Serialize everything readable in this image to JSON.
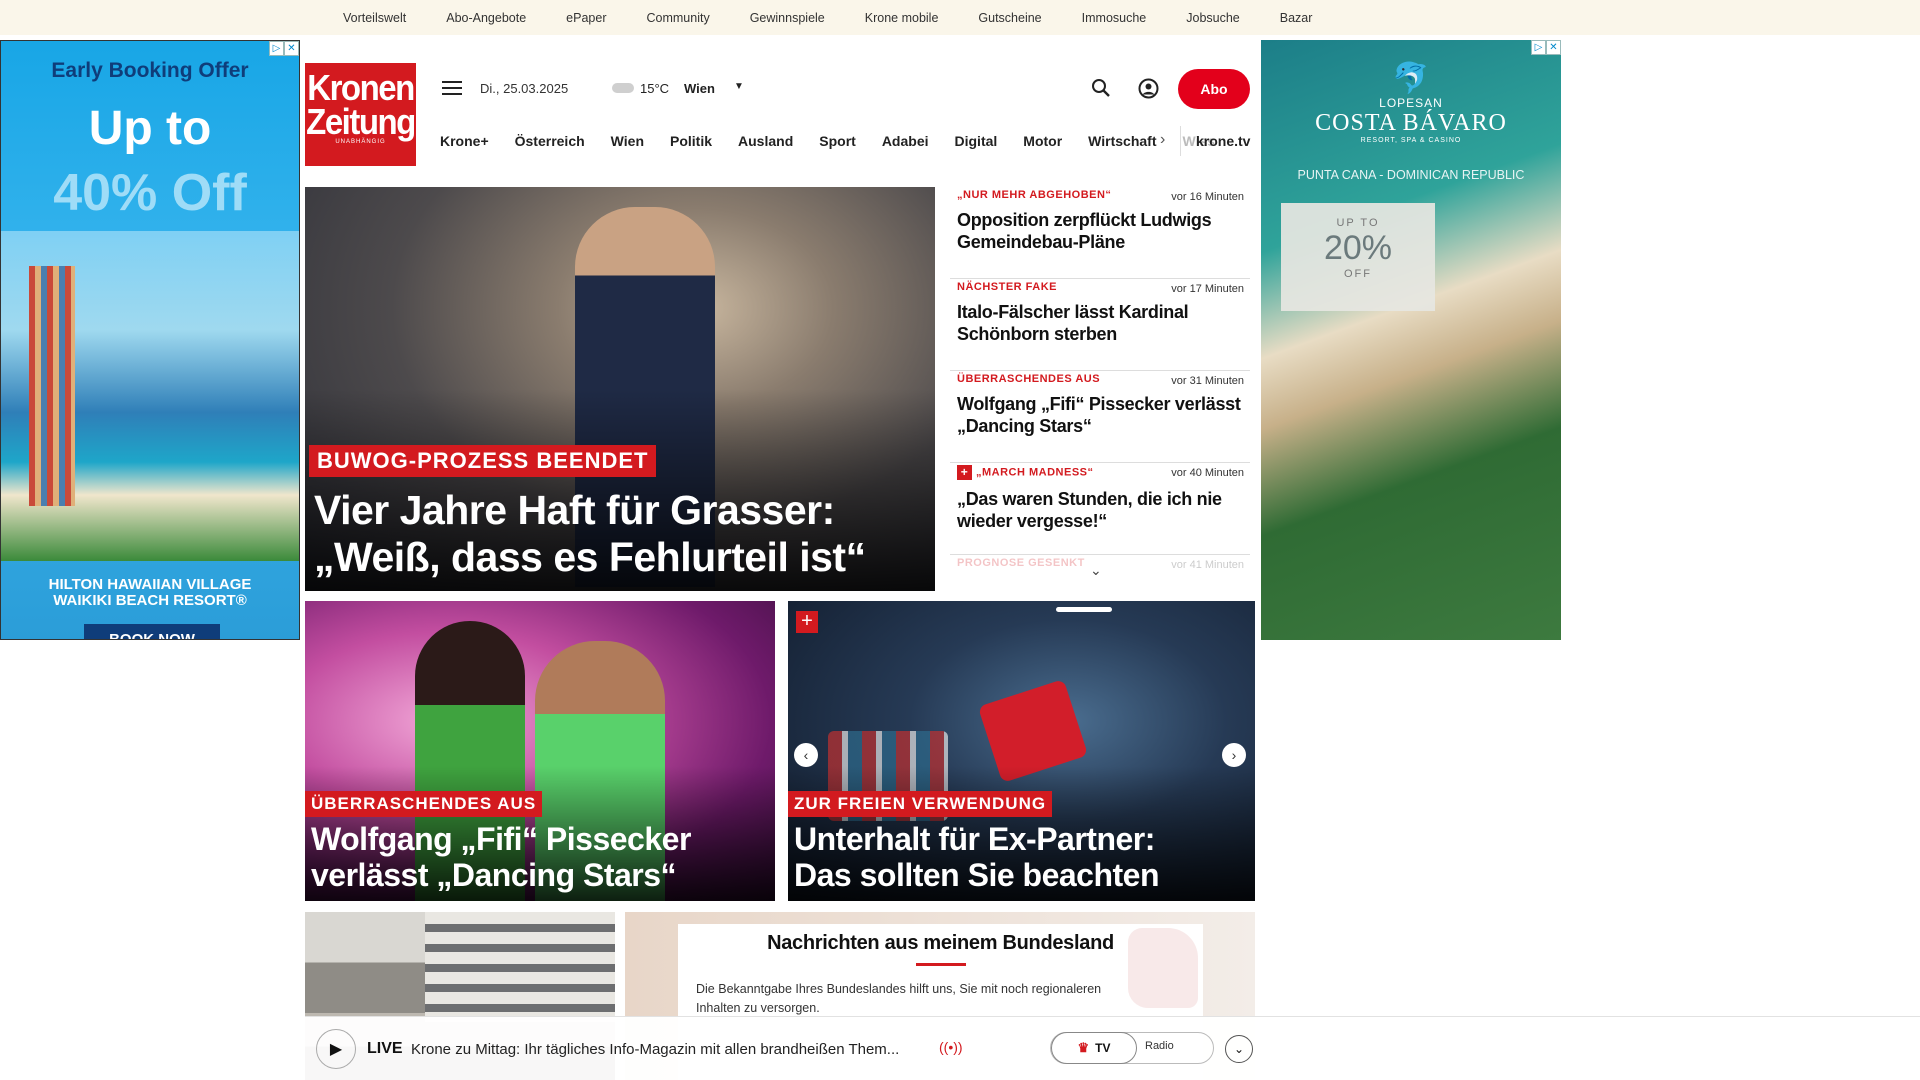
{
  "topbar": {
    "links": [
      "Vorteilswelt",
      "Abo-Angebote",
      "ePaper",
      "Community",
      "Gewinnspiele",
      "Krone mobile",
      "Gutscheine",
      "Immosuche",
      "Jobsuche",
      "Bazar"
    ]
  },
  "ad_left": {
    "headline": "Early Booking Offer",
    "upto": "Up to",
    "discount": "40% Off",
    "hotel_line1": "HILTON HAWAIIAN VILLAGE",
    "hotel_line2": "WAIKIKI BEACH RESORT®",
    "cta": "BOOK NOW"
  },
  "ad_right": {
    "brand_top": "LOPESAN",
    "brand": "COSTA BÁVARO",
    "brand_sub": "RESORT, SPA & CASINO",
    "location": "PUNTA CANA - DOMINICAN REPUBLIC",
    "promo_top": "UP TO",
    "promo_value": "20%",
    "promo_bottom": "OFF"
  },
  "header": {
    "logo_line1": "Kronen",
    "logo_line2": "Zeitung",
    "logo_tag": "UNABHÄNGIG",
    "date": "Di., 25.03.2025",
    "temperature": "15°C",
    "city": "Wien",
    "abo_label": "Abo",
    "nav": [
      "Krone+",
      "Österreich",
      "Wien",
      "Politik",
      "Ausland",
      "Sport",
      "Adabei",
      "Digital",
      "Motor",
      "Wirtschaft"
    ],
    "nav_faded": "Wiss",
    "kronetv": "krone.tv"
  },
  "hero": {
    "kicker": "BUWOG-PROZESS BEENDET",
    "title_line1": "Vier Jahre Haft für Grasser:",
    "title_line2": "„Weiß, dass es Fehlurteil ist“"
  },
  "news": [
    {
      "kicker": "„NUR MEHR ABGEHOBEN“",
      "time": "vor 16 Minuten",
      "headline": "Opposition zerpflückt Ludwigs Gemeindebau-Pläne"
    },
    {
      "kicker": "NÄCHSTER FAKE",
      "time": "vor 17 Minuten",
      "headline": "Italo-Fälscher lässt Kardinal Schönborn sterben"
    },
    {
      "kicker": "ÜBERRASCHENDES AUS",
      "time": "vor 31 Minuten",
      "headline": "Wolfgang „Fifi“ Pissecker verlässt „Dancing Stars“"
    },
    {
      "kicker": "„MARCH MADNESS“",
      "time": "vor 40 Minuten",
      "headline": "„Das waren Stunden, die ich nie wieder vergesse!“"
    },
    {
      "kicker": "PROGNOSE GESENKT",
      "time": "vor 41 Minuten",
      "headline": ""
    }
  ],
  "card1": {
    "kicker": "ÜBERRASCHENDES AUS",
    "title_line1": "Wolfgang „Fifi“ Pissecker",
    "title_line2": "verlässt „Dancing Stars“"
  },
  "card2": {
    "kicker": "ZUR FREIEN VERWENDUNG",
    "title_line1": "Unterhalt für Ex-Partner:",
    "title_line2": "Das sollten Sie beachten"
  },
  "bundesland": {
    "title": "Nachrichten aus meinem Bundesland",
    "text": "Die Bekanntgabe Ihres Bundeslandes hilft uns, Sie mit noch regionaleren Inhalten zu versorgen."
  },
  "livebar": {
    "live_label": "LIVE",
    "text": "Krone zu Mittag: Ihr tägliches Info-Magazin mit allen brandheißen Them...",
    "tv_label": "TV",
    "radio_label": "Radio"
  }
}
